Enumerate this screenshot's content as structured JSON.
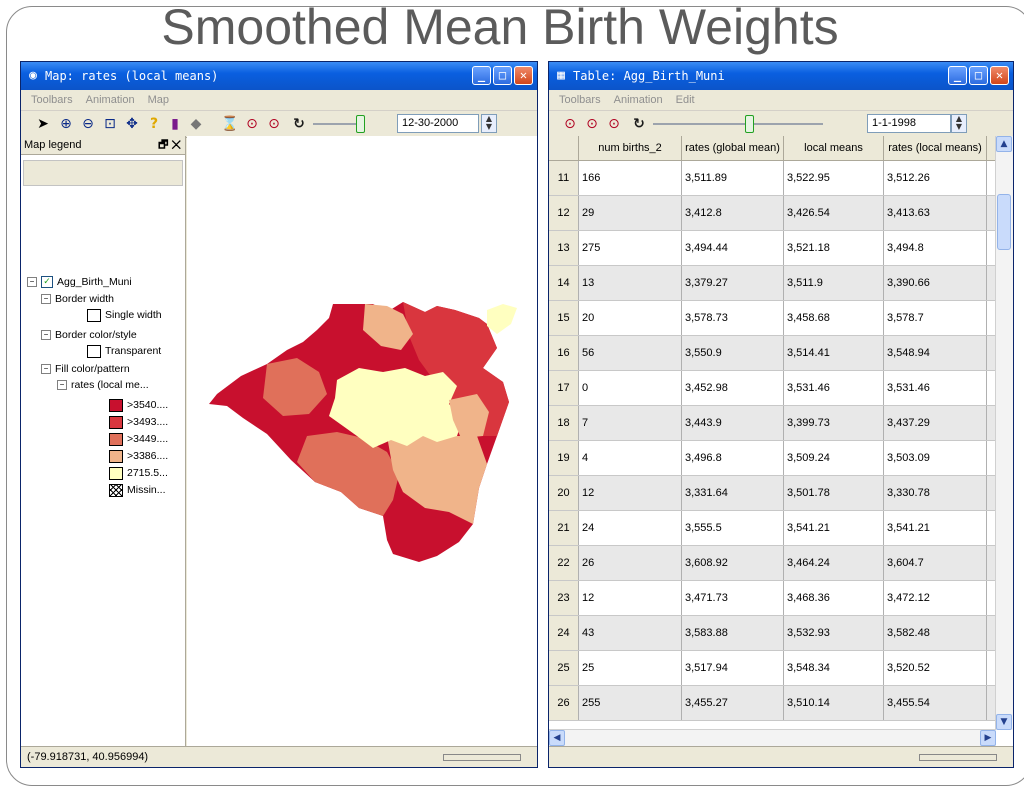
{
  "slide": {
    "title": "Smoothed Mean Birth Weights"
  },
  "map_window": {
    "title": "Map: rates (local means)",
    "menu": [
      "Toolbars",
      "Animation",
      "Map"
    ],
    "date": "12-30-2000",
    "legend": {
      "header": "Map legend",
      "layer": "Agg_Birth_Muni",
      "border_width_label": "Border width",
      "border_width_value": "Single width",
      "border_color_label": "Border color/style",
      "border_color_value": "Transparent",
      "fill_label": "Fill color/pattern",
      "fill_field": "rates (local me...",
      "classes": [
        {
          "label": ">3540....",
          "color": "#c8102e"
        },
        {
          "label": ">3493....",
          "color": "#d9363e"
        },
        {
          "label": ">3449....",
          "color": "#e0705a"
        },
        {
          "label": ">3386....",
          "color": "#f0b48a"
        },
        {
          "label": "2715.5...",
          "color": "#ffffc0"
        },
        {
          "label": "Missin...",
          "color": "#ffffff"
        }
      ]
    },
    "status": "(-79.918731, 40.956994)"
  },
  "table_window": {
    "title": "Table: Agg_Birth_Muni",
    "menu": [
      "Toolbars",
      "Animation",
      "Edit"
    ],
    "date": "1-1-1998",
    "columns": [
      "num births_2",
      "rates (global mean)",
      "local means",
      "rates (local means)"
    ],
    "rows": [
      {
        "id": "11",
        "cells": [
          "166",
          "3,511.89",
          "3,522.95",
          "3,512.26"
        ]
      },
      {
        "id": "12",
        "cells": [
          "29",
          "3,412.8",
          "3,426.54",
          "3,413.63"
        ]
      },
      {
        "id": "13",
        "cells": [
          "275",
          "3,494.44",
          "3,521.18",
          "3,494.8"
        ]
      },
      {
        "id": "14",
        "cells": [
          "13",
          "3,379.27",
          "3,511.9",
          "3,390.66"
        ]
      },
      {
        "id": "15",
        "cells": [
          "20",
          "3,578.73",
          "3,458.68",
          "3,578.7"
        ]
      },
      {
        "id": "16",
        "cells": [
          "56",
          "3,550.9",
          "3,514.41",
          "3,548.94"
        ]
      },
      {
        "id": "17",
        "cells": [
          "0",
          "3,452.98",
          "3,531.46",
          "3,531.46"
        ]
      },
      {
        "id": "18",
        "cells": [
          "7",
          "3,443.9",
          "3,399.73",
          "3,437.29"
        ]
      },
      {
        "id": "19",
        "cells": [
          "4",
          "3,496.8",
          "3,509.24",
          "3,503.09"
        ]
      },
      {
        "id": "20",
        "cells": [
          "12",
          "3,331.64",
          "3,501.78",
          "3,330.78"
        ]
      },
      {
        "id": "21",
        "cells": [
          "24",
          "3,555.5",
          "3,541.21",
          "3,541.21"
        ]
      },
      {
        "id": "22",
        "cells": [
          "26",
          "3,608.92",
          "3,464.24",
          "3,604.7"
        ]
      },
      {
        "id": "23",
        "cells": [
          "12",
          "3,471.73",
          "3,468.36",
          "3,472.12"
        ]
      },
      {
        "id": "24",
        "cells": [
          "43",
          "3,583.88",
          "3,532.93",
          "3,582.48"
        ]
      },
      {
        "id": "25",
        "cells": [
          "25",
          "3,517.94",
          "3,548.34",
          "3,520.52"
        ]
      },
      {
        "id": "26",
        "cells": [
          "255",
          "3,455.27",
          "3,510.14",
          "3,455.54"
        ]
      }
    ]
  }
}
